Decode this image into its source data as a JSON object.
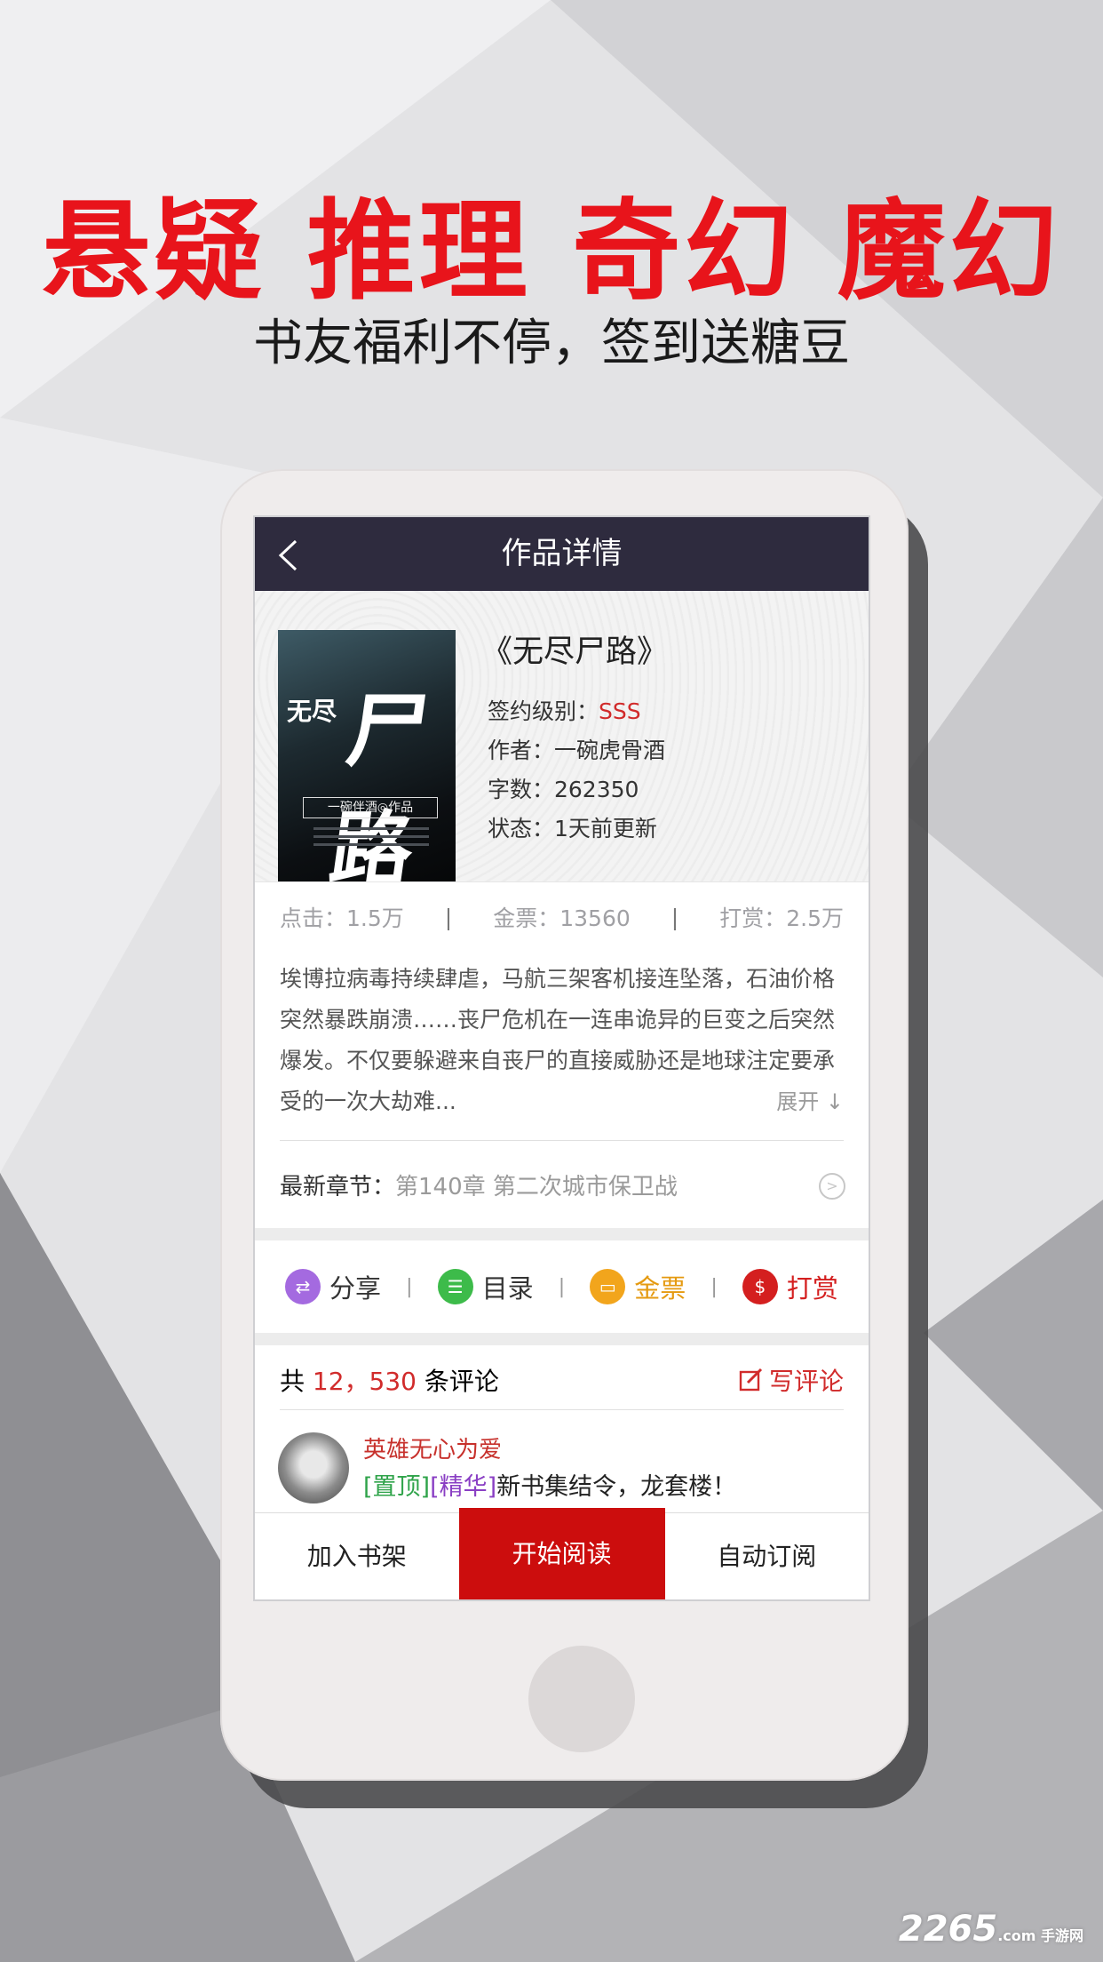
{
  "promo": {
    "headline": "悬疑  推理  奇幻  魔幻",
    "subline": "书友福利不停，签到送糖豆"
  },
  "navbar": {
    "title": "作品详情",
    "back_icon": "chevron-left-icon"
  },
  "book": {
    "name": "《无尽尸路》",
    "cover": {
      "title_small": "无尽",
      "title_big": "尸路",
      "band": "一碗伴酒◎作品"
    },
    "sign_level_label": "签约级别：",
    "sign_level_value": "SSS",
    "author": "作者：一碗虎骨酒",
    "word_count": "字数：262350",
    "status": "状态：1天前更新"
  },
  "stats": {
    "clicks": "点击：1.5万",
    "gold_tickets": "金票：13560",
    "rewards": "打赏：2.5万",
    "separator": "|"
  },
  "description": {
    "text": "埃博拉病毒持续肆虐，马航三架客机接连坠落，石油价格突然暴跌崩溃……丧尸危机在一连串诡异的巨变之后突然爆发。不仅要躲避来自丧尸的直接威胁还是地球注定要承受的一次大劫难...",
    "expand_label": "展开",
    "expand_icon": "arrow-down-icon"
  },
  "latest_chapter": {
    "label": "最新章节：",
    "value": "第140章  第二次城市保卫战",
    "arrow_icon": "circle-arrow-right-icon"
  },
  "actions": [
    {
      "label": "分享",
      "icon": "share-icon",
      "color": "#a46ae0",
      "glyph": "⇄"
    },
    {
      "label": "目录",
      "icon": "list-icon",
      "color": "#3dbb4a",
      "glyph": "☰"
    },
    {
      "label": "金票",
      "icon": "ticket-icon",
      "color": "#f2a51c",
      "glyph": "▭"
    },
    {
      "label": "打赏",
      "icon": "money-bag-icon",
      "color": "#d41f1f",
      "glyph": "$"
    }
  ],
  "comments": {
    "prefix": "共",
    "count": "12，530",
    "suffix": "条评论",
    "write_label": "写评论",
    "write_icon": "edit-icon",
    "items": [
      {
        "user": "英雄无心为爱",
        "tag_top": "[置顶]",
        "tag_best": "[精华]",
        "text": "新书集结令，龙套楼！"
      }
    ]
  },
  "bottom_bar": {
    "add_shelf": "加入书架",
    "start_read": "开始阅读",
    "auto_subscribe": "自动订阅"
  },
  "watermark": {
    "brand": "2265",
    "sub": ".com 手游网"
  },
  "colors": {
    "accent_red": "#e8141b",
    "navbar": "#2e2b3e",
    "primary_button": "#cc0d0d"
  }
}
